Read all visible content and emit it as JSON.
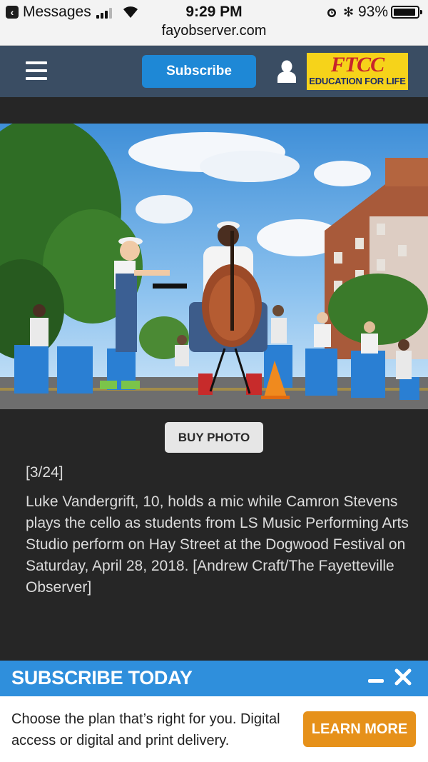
{
  "status_bar": {
    "back_label": "Messages",
    "time": "9:29 PM",
    "battery_pct": "93%",
    "battery_level": 0.93,
    "url": "fayobserver.com"
  },
  "header": {
    "subscribe_label": "Subscribe",
    "ad_logo": "FTCC",
    "ad_tagline": "EDUCATION FOR LIFE"
  },
  "photo_caption": {
    "buy_photo_label": "BUY PHOTO",
    "counter": "[3/24]",
    "text": "Luke Vandergrift, 10, holds a mic while Camron Stevens plays the cello as students from LS Music Performing Arts Studio perform on Hay Street at the Dogwood Festival on Saturday, April 28, 2018. [Andrew Craft/The Fayetteville Observer]"
  },
  "subscribe_banner": {
    "title": "SUBSCRIBE TODAY",
    "body": "Choose the plan that’s right for you. Digital access or digital and print delivery.",
    "button_label": "LEARN MORE"
  },
  "colors": {
    "header_bg": "#3a4d63",
    "subscribe_blue": "#1e88d6",
    "banner_blue": "#2f8fdc",
    "learn_more_orange": "#e6911a",
    "page_bg": "#262626"
  }
}
